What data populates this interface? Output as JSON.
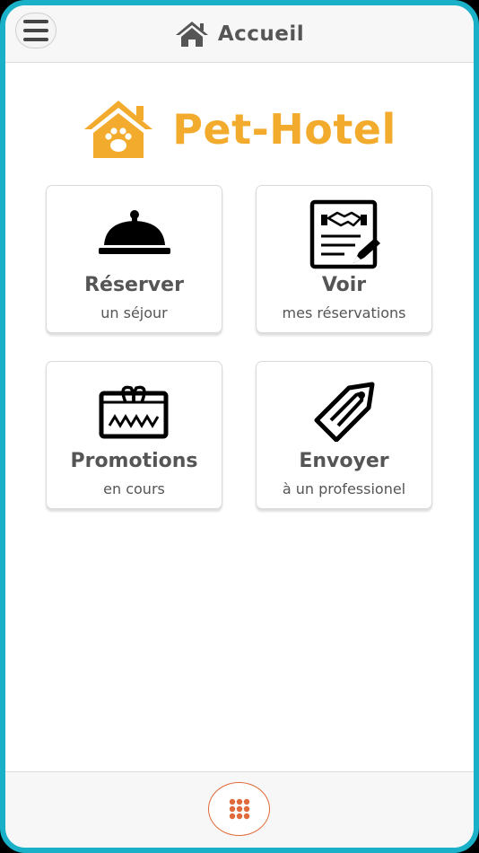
{
  "header": {
    "title": "Accueil",
    "menu_icon": "hamburger-menu-icon",
    "title_icon": "home-icon"
  },
  "brand": {
    "name": "Pet-Hotel",
    "logo_icon": "pet-house-paw-icon",
    "color": "#f2ab2c"
  },
  "cards": [
    {
      "icon": "service-bell-icon",
      "title": "Réserver",
      "subtitle": "un séjour"
    },
    {
      "icon": "contract-handshake-icon",
      "title": "Voir",
      "subtitle": "mes réservations"
    },
    {
      "icon": "gift-card-icon",
      "title": "Promotions",
      "subtitle": "en cours"
    },
    {
      "icon": "price-tag-icon",
      "title": "Envoyer",
      "subtitle": "à un professionel"
    }
  ],
  "footer": {
    "apps_icon": "grid-dots-icon",
    "accent": "#e06a3a"
  },
  "colors": {
    "frame": "#1ab0c8",
    "text": "#555555"
  }
}
